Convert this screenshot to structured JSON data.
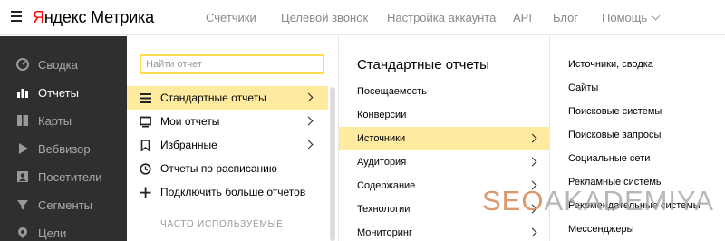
{
  "header": {
    "logo_ya": "Я",
    "logo_rest": "ндекс Метрика",
    "nav": [
      "Счетчики",
      "Целевой звонок",
      "Настройка аккаунта",
      "API",
      "Блог",
      "Помощь"
    ]
  },
  "sidebar": {
    "items": [
      {
        "label": "Сводка",
        "icon": "dashboard-icon"
      },
      {
        "label": "Отчеты",
        "icon": "bar-chart-icon"
      },
      {
        "label": "Карты",
        "icon": "map-icon"
      },
      {
        "label": "Вебвизор",
        "icon": "play-icon"
      },
      {
        "label": "Посетители",
        "icon": "visitors-icon"
      },
      {
        "label": "Сегменты",
        "icon": "filter-icon"
      },
      {
        "label": "Цели",
        "icon": "target-icon"
      }
    ],
    "active": "Отчеты"
  },
  "reports_menu": {
    "search_placeholder": "Найти отчет",
    "items": [
      {
        "label": "Стандартные отчеты",
        "icon": "list-icon"
      },
      {
        "label": "Мои отчеты",
        "icon": "monitor-icon"
      },
      {
        "label": "Избранные",
        "icon": "bookmark-icon"
      },
      {
        "label": "Отчеты по расписанию",
        "icon": "clock-icon"
      },
      {
        "label": "Подключить больше отчетов",
        "icon": "plus-icon"
      }
    ],
    "section_title": "ЧАСТО ИСПОЛЬЗУЕМЫЕ"
  },
  "standard_reports": {
    "title": "Стандартные отчеты",
    "items": [
      "Посещаемость",
      "Конверсии",
      "Источники",
      "Аудитория",
      "Содержание",
      "Технологии",
      "Мониторинг"
    ]
  },
  "sources": {
    "items": [
      "Источники, сводка",
      "Сайты",
      "Поисковые системы",
      "Поисковые запросы",
      "Социальные сети",
      "Рекламные системы",
      "Рекомендательные системы",
      "Мессенджеры"
    ]
  },
  "watermark": {
    "part1": "SEO",
    "part2": "AKADEMIYA"
  },
  "colors": {
    "accent": "#ffdb4d",
    "highlight": "#ffeba0",
    "sidebar_bg": "#2f2f2f",
    "logo_red": "#ff0000"
  }
}
